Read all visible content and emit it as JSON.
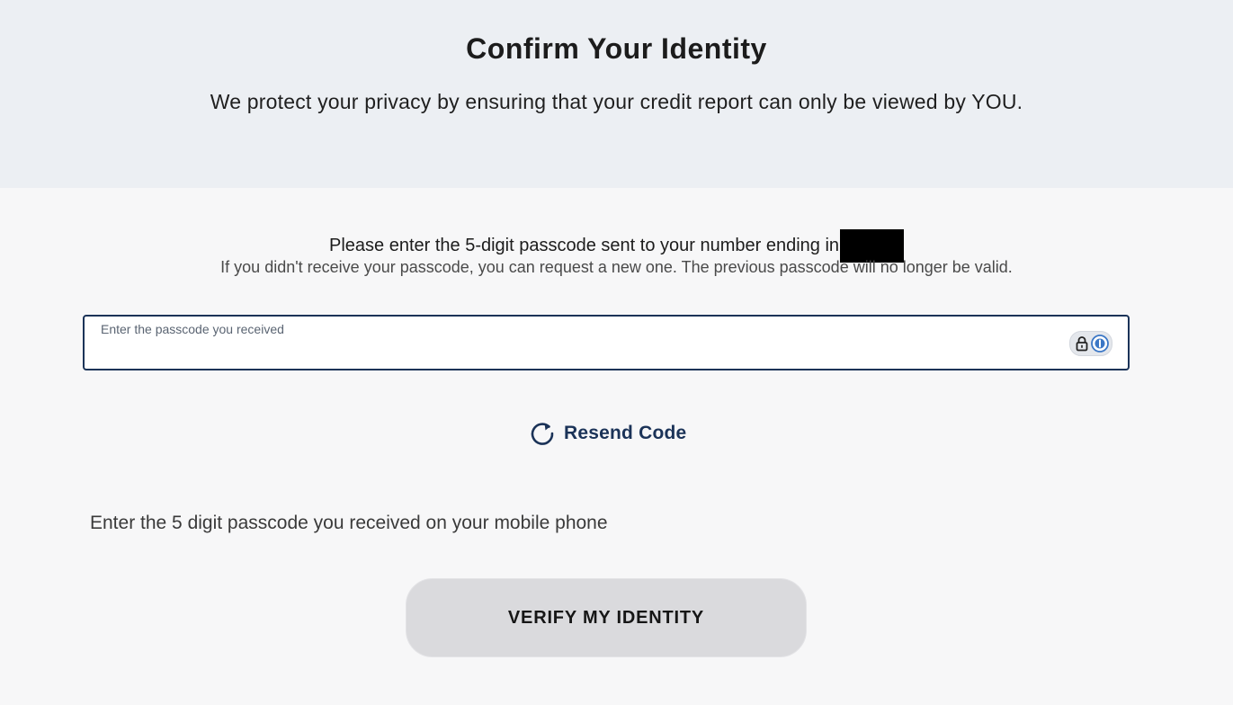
{
  "header": {
    "title": "Confirm Your Identity",
    "subtitle": "We protect your privacy by ensuring that your credit report can only be viewed by YOU."
  },
  "instructions": {
    "prompt": "Please enter the 5-digit passcode sent to your number ending in",
    "note": "If you didn't receive your passcode, you can request a new one. The previous passcode will no longer be valid."
  },
  "passcode_field": {
    "label": "Enter the passcode you received",
    "value": "",
    "password_manager_icons": [
      "lock-icon",
      "password-manager-key-icon"
    ]
  },
  "resend": {
    "icon": "refresh-icon",
    "label": "Resend Code"
  },
  "helper_text": "Enter the 5 digit passcode you received on your mobile phone",
  "verify_button": {
    "label": "VERIFY MY IDENTITY"
  },
  "colors": {
    "hero_bg": "#eceff3",
    "page_bg": "#f7f7f8",
    "accent_navy": "#1b3358",
    "button_bg": "#dadadd",
    "redaction": "#000000"
  }
}
